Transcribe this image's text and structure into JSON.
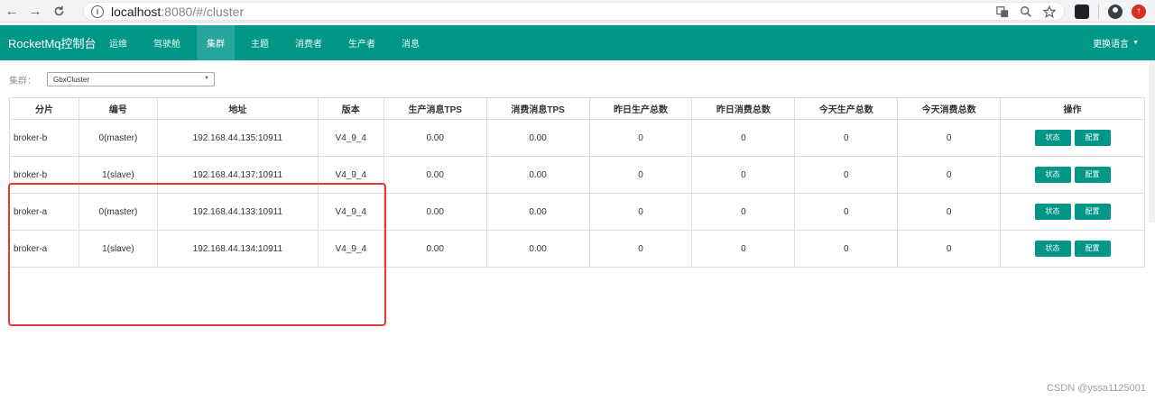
{
  "browser": {
    "back_icon": "←",
    "forward_icon": "→",
    "reload_icon": "C",
    "url_host": "localhost",
    "url_rest": ":8080/#/cluster"
  },
  "navbar": {
    "brand": "RocketMq控制台",
    "items": [
      {
        "label": "运维"
      },
      {
        "label": "驾驶舱"
      },
      {
        "label": "集群"
      },
      {
        "label": "主题"
      },
      {
        "label": "消费者"
      },
      {
        "label": "生产者"
      },
      {
        "label": "消息"
      }
    ],
    "active_index": 2,
    "language": "更换语言"
  },
  "cluster_filter": {
    "label": "集群：",
    "selected": "GbxCluster"
  },
  "table": {
    "headers": [
      "分片",
      "编号",
      "地址",
      "版本",
      "生产消息TPS",
      "消费消息TPS",
      "昨日生产总数",
      "昨日消费总数",
      "今天生产总数",
      "今天消费总数",
      "操作"
    ],
    "rows": [
      {
        "shard": "broker-b",
        "id": "0(master)",
        "address": "192.168.44.135:10911",
        "version": "V4_9_4",
        "produce_tps": "0.00",
        "consume_tps": "0.00",
        "yesterday_produce": "0",
        "yesterday_consume": "0",
        "today_produce": "0",
        "today_consume": "0"
      },
      {
        "shard": "broker-b",
        "id": "1(slave)",
        "address": "192.168.44.137:10911",
        "version": "V4_9_4",
        "produce_tps": "0.00",
        "consume_tps": "0.00",
        "yesterday_produce": "0",
        "yesterday_consume": "0",
        "today_produce": "0",
        "today_consume": "0"
      },
      {
        "shard": "broker-a",
        "id": "0(master)",
        "address": "192.168.44.133:10911",
        "version": "V4_9_4",
        "produce_tps": "0.00",
        "consume_tps": "0.00",
        "yesterday_produce": "0",
        "yesterday_consume": "0",
        "today_produce": "0",
        "today_consume": "0"
      },
      {
        "shard": "broker-a",
        "id": "1(slave)",
        "address": "192.168.44.134:10911",
        "version": "V4_9_4",
        "produce_tps": "0.00",
        "consume_tps": "0.00",
        "yesterday_produce": "0",
        "yesterday_consume": "0",
        "today_produce": "0",
        "today_consume": "0"
      }
    ],
    "status_button": "状态",
    "config_button": "配置"
  },
  "watermark": "CSDN @yssa1125001",
  "colors": {
    "primary": "#009688",
    "highlight": "#e53935"
  }
}
